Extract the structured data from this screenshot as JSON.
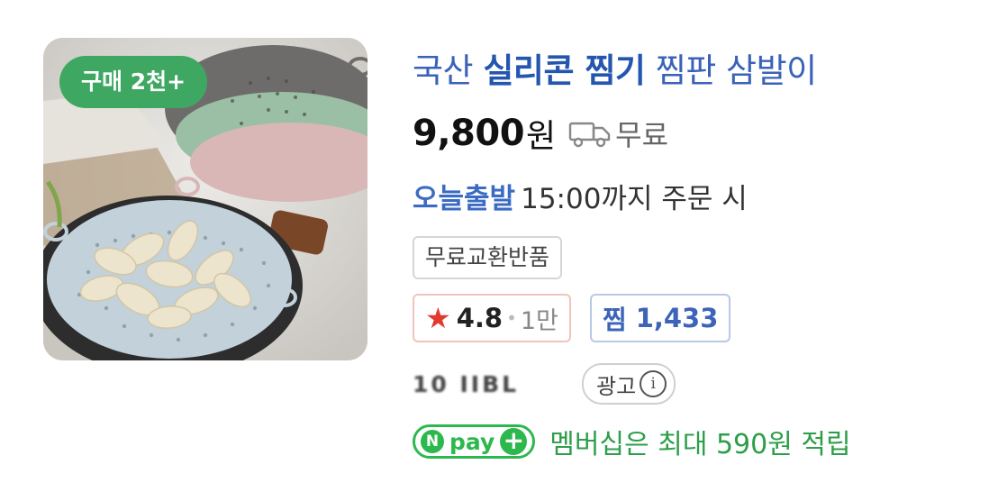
{
  "product": {
    "purchase_badge": "구매 2천+",
    "title_prefix": "국산",
    "title_highlight": "실리콘 찜기",
    "title_suffix": "찜판 삼발이",
    "price_value": "9,800",
    "price_unit": "원",
    "shipping": "무료",
    "delivery_tag": "오늘출발",
    "delivery_text": "15:00까지 주문 시",
    "return_tag": "무료교환반품",
    "rating": "4.8",
    "review_count": "1만",
    "wish_label": "찜",
    "wish_count": "1,433",
    "seller_name": "10 IIBL",
    "ad_label": "광고",
    "npay_logo": "pay",
    "npay_benefit": "멤버십은 최대 590원 적립"
  },
  "colors": {
    "badge_green": "#3ea862",
    "title_blue": "#3a62b8",
    "star_red": "#e23a2e",
    "npay_green": "#2db84d"
  },
  "icons": {
    "shipping": "truck-icon",
    "rating": "star-icon",
    "ad_info": "info-icon",
    "npay_plus": "plus-icon"
  }
}
